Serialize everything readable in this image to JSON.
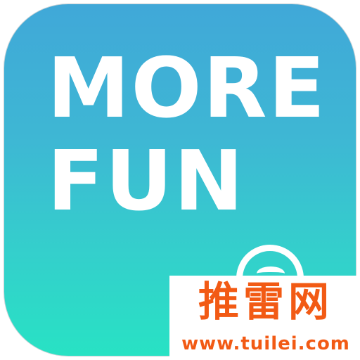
{
  "icon": {
    "line1": "MORE",
    "line2": "FUN",
    "badge_icon": "circle-tilde-icon",
    "colors": {
      "gradient_top": "#40a8d8",
      "gradient_bottom": "#28e2c4",
      "text": "#ffffff"
    }
  },
  "watermark": {
    "title": "推雷网",
    "url": "www.tuilei.com",
    "color": "#f25a14"
  }
}
